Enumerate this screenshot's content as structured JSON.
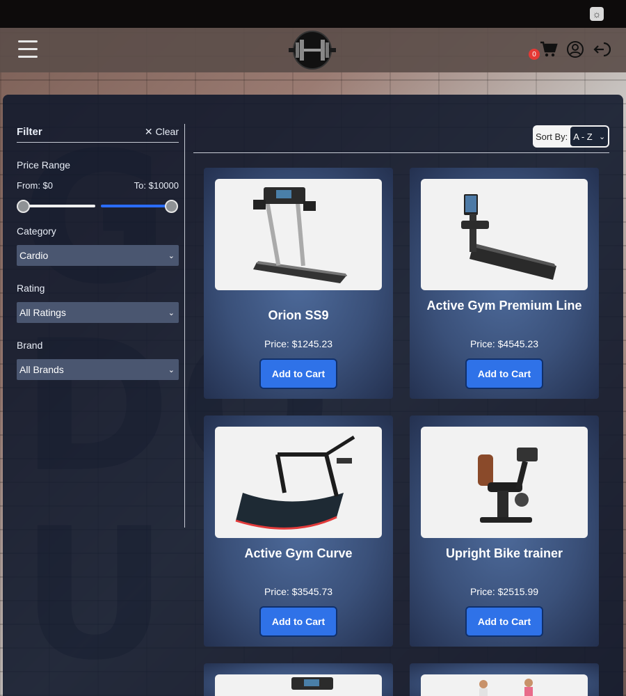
{
  "header": {
    "theme_icon": "sun-icon",
    "menu_icon": "hamburger-menu-icon",
    "logo_icon": "dumbbell-logo",
    "cart_count": "0",
    "icons": [
      "cart-icon",
      "user-icon",
      "logout-icon"
    ]
  },
  "filter": {
    "title": "Filter",
    "clear_label": "✕ Clear",
    "price_range_label": "Price Range",
    "from_label": "From: $0",
    "to_label": "To: $10000",
    "category_label": "Category",
    "category_value": "Cardio",
    "rating_label": "Rating",
    "rating_value": "All Ratings",
    "brand_label": "Brand",
    "brand_value": "All Brands"
  },
  "sort": {
    "label": "Sort By:",
    "value": "A - Z"
  },
  "products": [
    {
      "name": "Orion SS9",
      "price": "Price: $1245.23",
      "button": "Add to Cart"
    },
    {
      "name": "Active Gym Premium Line",
      "price": "Price: $4545.23",
      "button": "Add to Cart"
    },
    {
      "name": "Active Gym Curve",
      "price": "Price: $3545.73",
      "button": "Add to Cart"
    },
    {
      "name": "Upright Bike trainer",
      "price": "Price: $2515.99",
      "button": "Add to Cart"
    }
  ],
  "colors": {
    "accent": "#2f72e8",
    "badge": "#e53935",
    "panel": "#121a2c"
  }
}
